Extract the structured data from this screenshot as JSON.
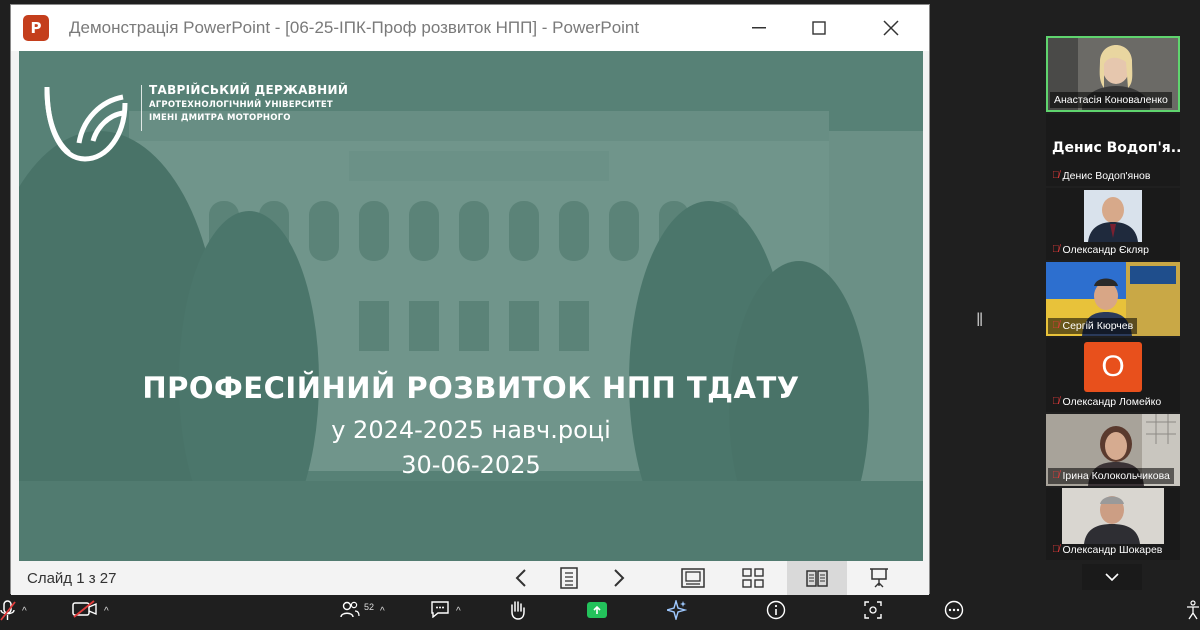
{
  "window": {
    "app_icon_letter": "P",
    "title": "Демонстрація PowerPoint - [06-25-ІПК-Проф розвиток НПП] - PowerPoint"
  },
  "slide": {
    "university_line1": "ТАВРІЙСЬКИЙ ДЕРЖАВНИЙ",
    "university_line2": "АГРОТЕХНОЛОГІЧНИЙ УНІВЕРСИТЕТ",
    "university_line3": "ІМЕНІ ДМИТРА МОТОРНОГО",
    "heading": "ПРОФЕСІЙНИЙ РОЗВИТОК НПП ТДАТУ",
    "subheading": "у 2024-2025 навч.році",
    "date": "30-06-2025",
    "accent_color": "#4f7b6f"
  },
  "statusbar": {
    "slide_counter": "Слайд 1 з 27",
    "buttons": [
      "previous-slide",
      "see-all-slides",
      "next-slide",
      "normal-view",
      "slide-sorter-view",
      "reading-view",
      "slide-show"
    ]
  },
  "participants": {
    "active_speaker_border": "#5fd46e",
    "items": [
      {
        "name": "Анастасія Коноваленко",
        "muted": false
      },
      {
        "display_name": "Денис Водоп'я...",
        "name": "Денис Водоп'янов",
        "muted": true
      },
      {
        "name": "Олександр Єкляр",
        "muted": true
      },
      {
        "name": "Сергій Кюрчев",
        "muted": true
      },
      {
        "initial": "О",
        "name": "Олександр Ломейко",
        "muted": true
      },
      {
        "name": "Ірина Колокольчикова",
        "muted": true
      },
      {
        "name": "Олександр Шокарев",
        "muted": true
      }
    ]
  },
  "toolbar": {
    "participants_count": "52",
    "share_color": "#23c25b"
  }
}
